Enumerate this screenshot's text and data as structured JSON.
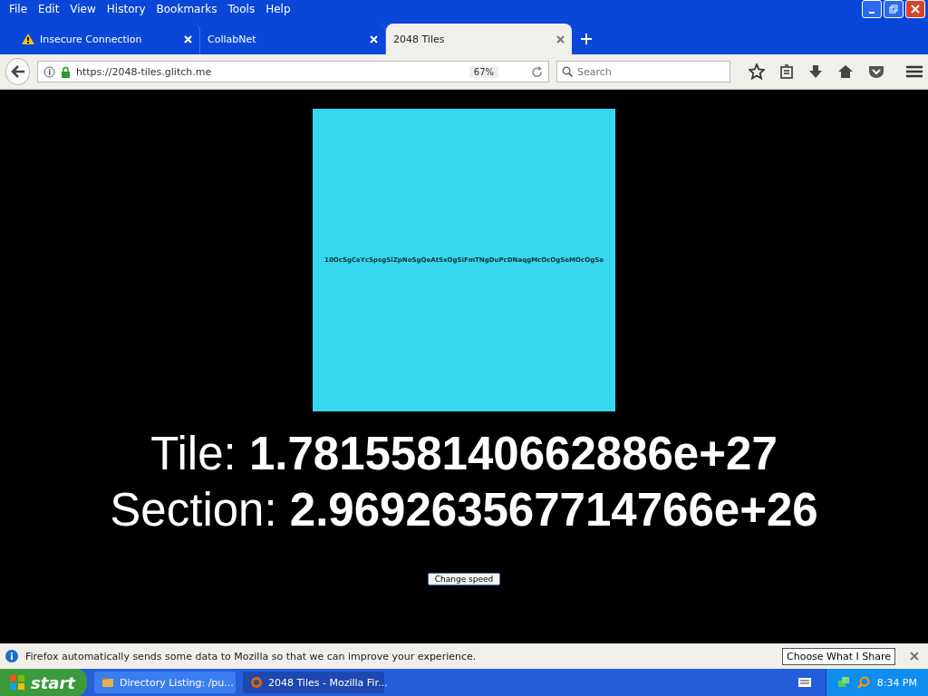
{
  "menu": [
    "File",
    "Edit",
    "View",
    "History",
    "Bookmarks",
    "Tools",
    "Help"
  ],
  "tabs": [
    {
      "label": "Insecure Connection",
      "warning": true,
      "selected": false
    },
    {
      "label": "CollabNet",
      "warning": false,
      "selected": false
    },
    {
      "label": "2048 Tiles",
      "warning": false,
      "selected": true
    }
  ],
  "address": {
    "value": "https://2048-tiles.glitch.me",
    "zoom": "67%"
  },
  "search": {
    "placeholder": "Search"
  },
  "page": {
    "tile_text": "10OcSgCeYcSpsgSiZpNoSgQeAtSxOgSiFmTNgDuPcDNaqgMcOcOgSeMOcOgSe",
    "tile_label": "Tile: ",
    "tile_value": "1.781558140662886e+27",
    "section_label": "Section: ",
    "section_value": "2.969263567714766e+26",
    "button": "Change speed"
  },
  "notification": {
    "text": "Firefox automatically sends some data to Mozilla so that we can improve your experience.",
    "button": "Choose What I Share"
  },
  "taskbar": {
    "start": "start",
    "tasks": [
      {
        "label": "Directory Listing: /pu...",
        "selected": false
      },
      {
        "label": "2048 Tiles - Mozilla Fir...",
        "selected": true
      }
    ],
    "clock": "8:34 PM"
  }
}
